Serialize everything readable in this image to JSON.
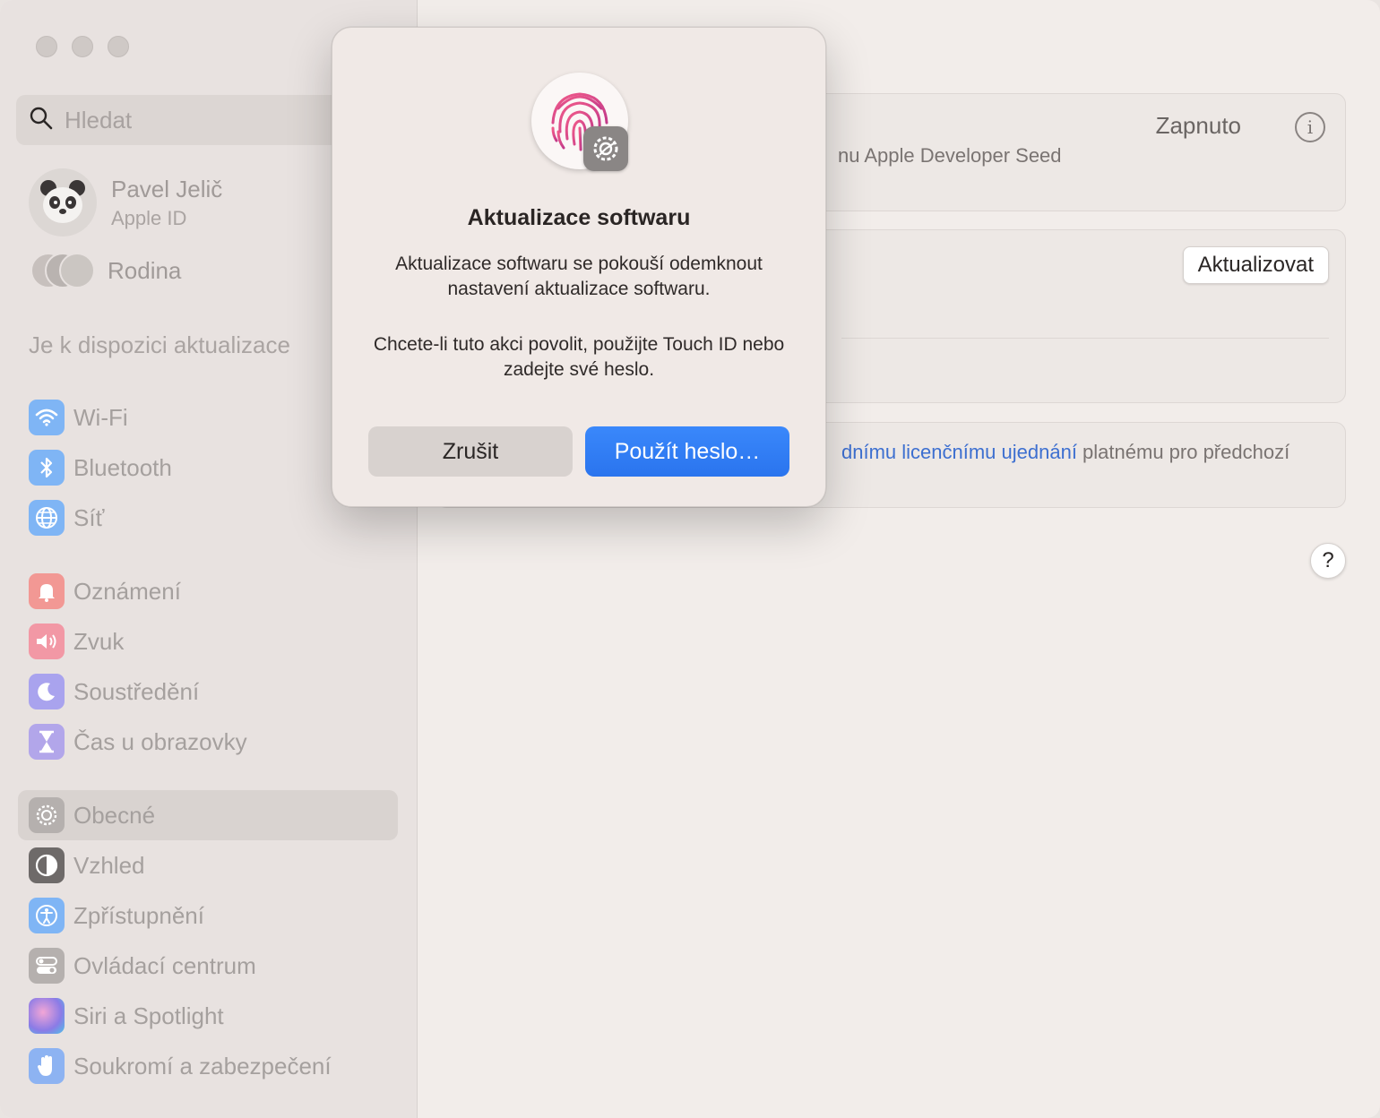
{
  "sidebar": {
    "search_placeholder": "Hledat",
    "profile": {
      "name": "Pavel Jelič",
      "subtitle": "Apple ID"
    },
    "family_label": "Rodina",
    "update_available": "Je k dispozici aktualizace",
    "groups": [
      [
        {
          "label": "Wi-Fi",
          "icon": "wifi-icon",
          "color": "#5fa5f5"
        },
        {
          "label": "Bluetooth",
          "icon": "bluetooth-icon",
          "color": "#5fa5f5"
        },
        {
          "label": "Síť",
          "icon": "globe-icon",
          "color": "#5fa5f5"
        }
      ],
      [
        {
          "label": "Oznámení",
          "icon": "bell-icon",
          "color": "#f07b78"
        },
        {
          "label": "Zvuk",
          "icon": "speaker-icon",
          "color": "#f07b8c"
        },
        {
          "label": "Soustředění",
          "icon": "moon-icon",
          "color": "#8d86e8"
        },
        {
          "label": "Čas u obrazovky",
          "icon": "hourglass-icon",
          "color": "#9a8ae0"
        }
      ],
      [
        {
          "label": "Obecné",
          "icon": "gear-icon",
          "color": "#a8a3a1",
          "active": true
        },
        {
          "label": "Vzhled",
          "icon": "appearance-icon",
          "color": "#3c3a3a"
        },
        {
          "label": "Zpřístupnění",
          "icon": "accessibility-icon",
          "color": "#5fa5f5"
        },
        {
          "label": "Ovládací centrum",
          "icon": "toggles-icon",
          "color": "#a8a3a1"
        },
        {
          "label": "Siri a Spotlight",
          "icon": "siri-icon",
          "color": "#b889e0"
        },
        {
          "label": "Soukromí a zabezpečení",
          "icon": "hand-icon",
          "color": "#7aa8f0"
        }
      ]
    ]
  },
  "main": {
    "beta_status": "Zapnuto",
    "beta_text": "nu Apple Developer Seed",
    "update_button": "Aktualizovat",
    "license_link": "dnímu licenčnímu ujednání",
    "license_text": " platnému pro předchozí",
    "help_label": "?"
  },
  "dialog": {
    "title": "Aktualizace softwaru",
    "message1": "Aktualizace softwaru se pokouší odemknout nastavení aktualizace softwaru.",
    "message2": "Chcete-li tuto akci povolit, použijte Touch ID nebo zadejte své heslo.",
    "cancel": "Zrušit",
    "use_password": "Použít heslo…"
  },
  "colors": {
    "accent": "#2f7df6",
    "link": "#3d6fd0"
  }
}
